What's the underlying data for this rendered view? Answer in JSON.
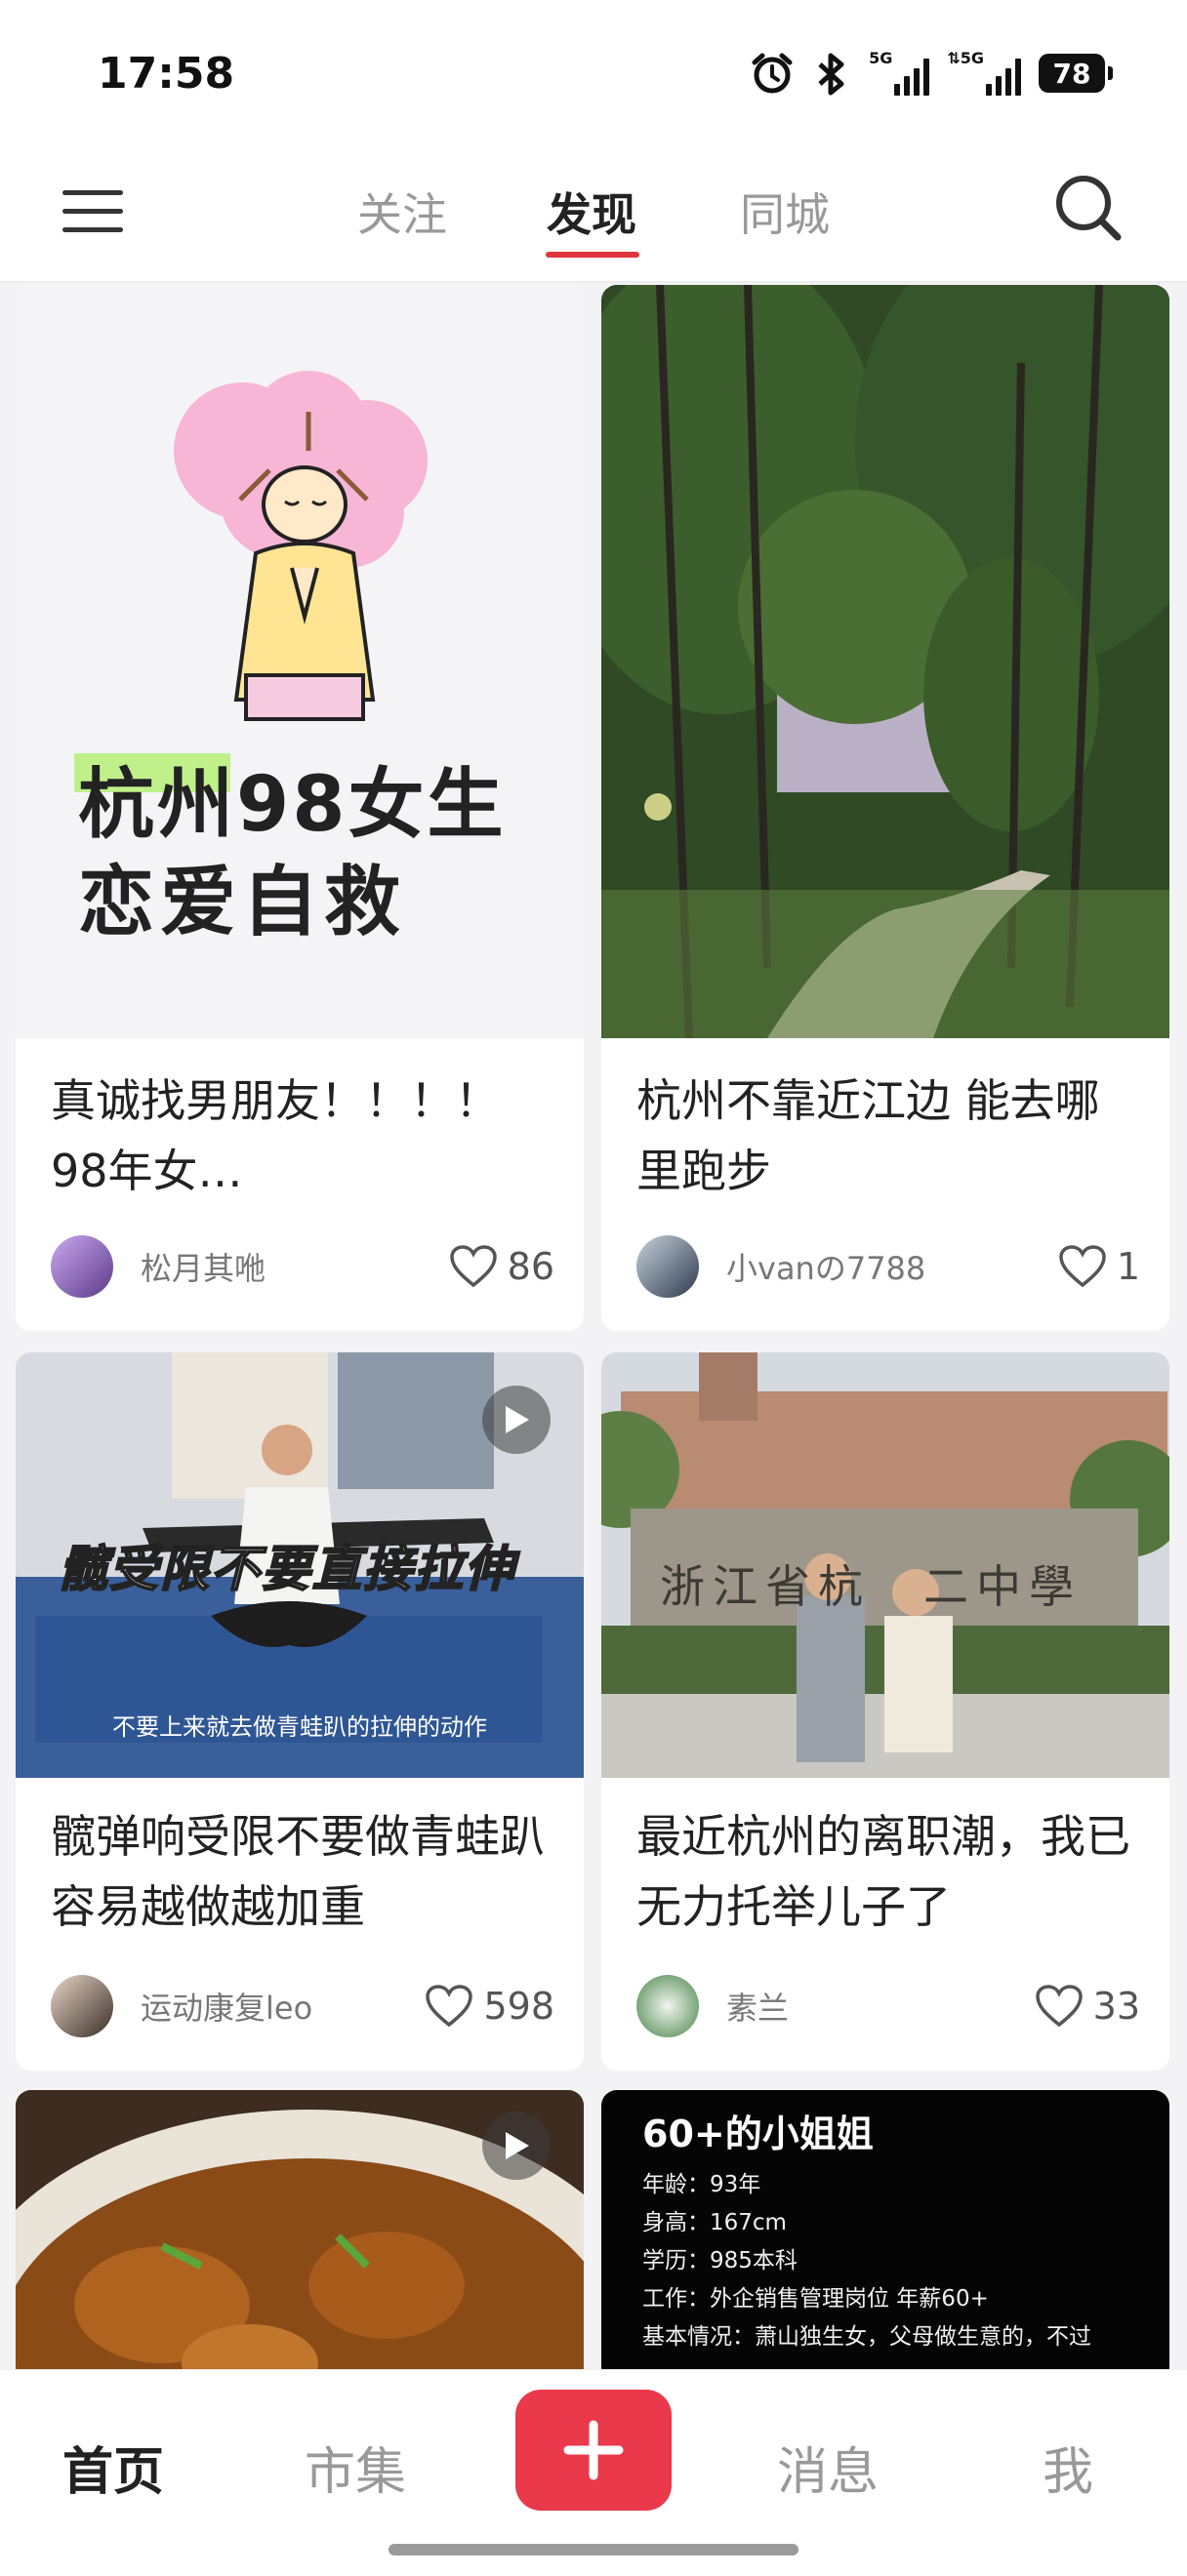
{
  "status_bar": {
    "time": "17:58",
    "battery": "78",
    "network_1": "5G",
    "network_2": "⇅5G"
  },
  "top_nav": {
    "tabs": [
      "关注",
      "发现",
      "同城"
    ],
    "active_tab": "发现"
  },
  "feed": [
    {
      "cover_text_1": "杭州98女生",
      "cover_text_2": "恋爱自救",
      "title": "真诚找男朋友！！！！98年女…",
      "author": "松月其咃",
      "likes": "86"
    },
    {
      "title": "杭州不靠近江边 能去哪里跑步",
      "author": "小vanの7788",
      "likes": "1"
    },
    {
      "cover_caption": "髋受限不要直接拉伸",
      "cover_subtitle": "不要上来就去做青蛙趴的拉伸的动作",
      "title": "髋弹响受限不要做青蛙趴容易越做越加重",
      "author": "运动康复leo",
      "likes": "598"
    },
    {
      "cover_sign": "浙江省杭　二中學",
      "title": "最近杭州的离职潮，我已无力托举儿子了",
      "author": "素兰",
      "likes": "33"
    },
    {},
    {
      "cover_heading": "60+的小姐姐",
      "cover_lines": [
        "年龄：93年",
        "身高：167cm",
        "学历：985本科",
        "工作：外企销售管理岗位 年薪60+",
        "基本情况：萧山独生女，父母做生意的，不过"
      ]
    }
  ],
  "bottom_nav": {
    "home": "首页",
    "market": "市集",
    "messages": "消息",
    "me": "我"
  },
  "colors": {
    "accent": "#e9394a",
    "underline": "#e0353d"
  },
  "icons": [
    "alarm-icon",
    "bluetooth-icon",
    "signal-icon",
    "battery-icon",
    "menu-icon",
    "search-icon",
    "heart-icon",
    "play-icon",
    "plus-icon"
  ]
}
